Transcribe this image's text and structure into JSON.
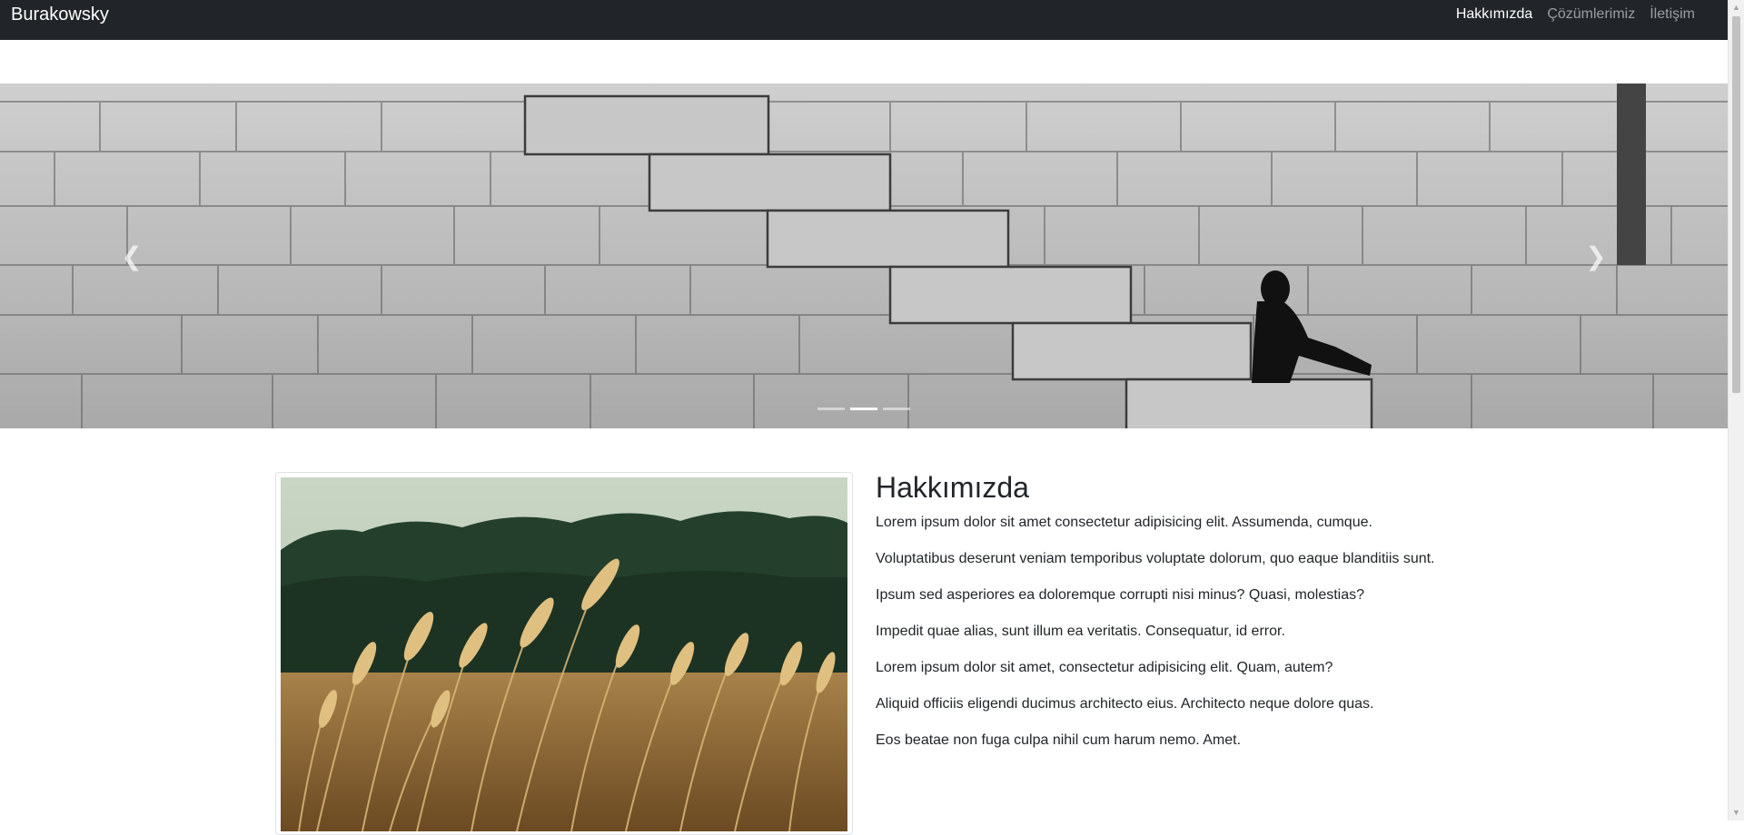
{
  "navbar": {
    "brand": "Burakowsky",
    "links": [
      {
        "label": "Hakkımızda",
        "active": true
      },
      {
        "label": "Çözümlerimiz",
        "active": false
      },
      {
        "label": "İletişim",
        "active": false
      }
    ]
  },
  "carousel": {
    "prev_icon": "chevron-left-icon",
    "next_icon": "chevron-right-icon",
    "indicator_count": 3,
    "active_indicator": 1
  },
  "about": {
    "title": "Hakkımızda",
    "paragraphs": [
      "Lorem ipsum dolor sit amet consectetur adipisicing elit. Assumenda, cumque.",
      "Voluptatibus deserunt veniam temporibus voluptate dolorum, quo eaque blanditiis sunt.",
      "Ipsum sed asperiores ea doloremque corrupti nisi minus? Quasi, molestias?",
      "Impedit quae alias, sunt illum ea veritatis. Consequatur, id error.",
      "Lorem ipsum dolor sit amet, consectetur adipisicing elit. Quam, autem?",
      "Aliquid officiis eligendi ducimus architecto eius. Architecto neque dolore quas.",
      "Eos beatae non fuga culpa nihil cum harum nemo. Amet."
    ]
  },
  "colors": {
    "navbar_bg": "#212529",
    "text": "#212529",
    "nav_active": "#ffffff",
    "nav_inactive": "rgba(255,255,255,0.55)"
  }
}
